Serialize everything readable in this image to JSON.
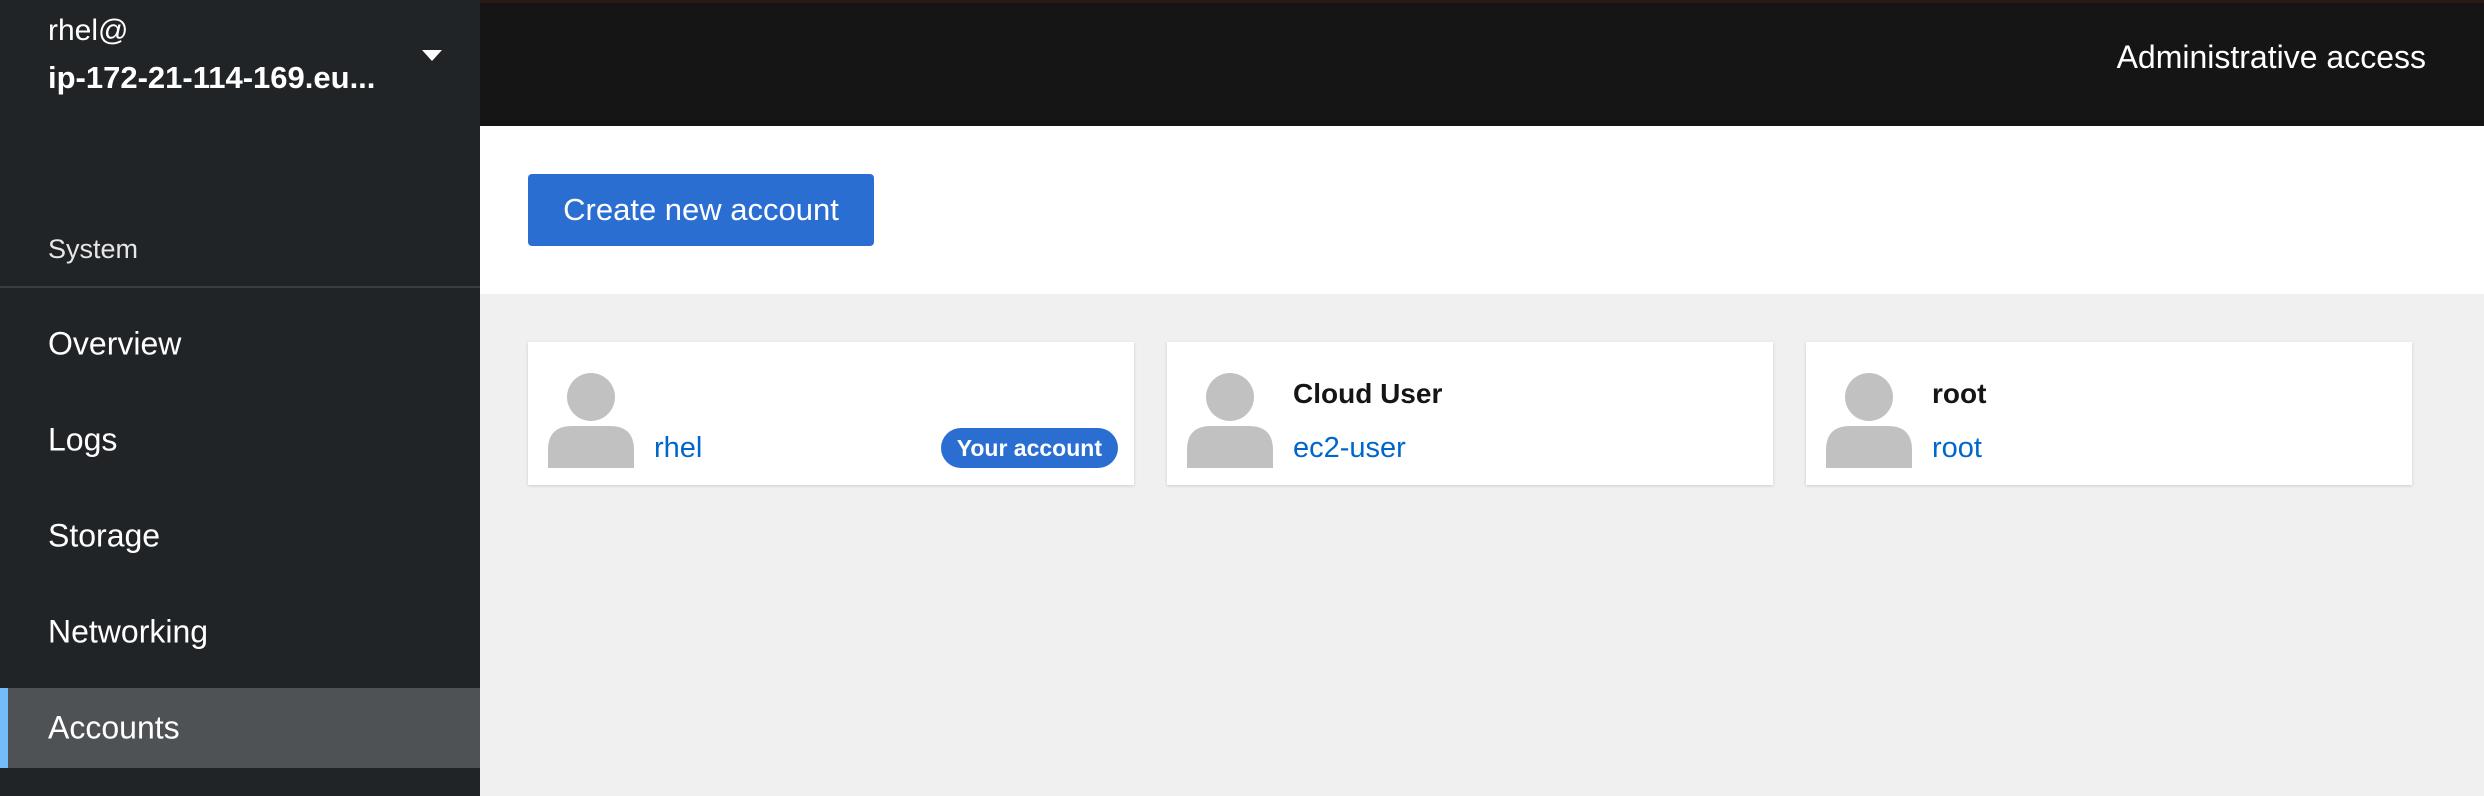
{
  "host": {
    "user": "rhel@",
    "name": "ip-172-21-114-169.eu..."
  },
  "header": {
    "admin_access": "Administrative access"
  },
  "sidebar": {
    "section_label": "System",
    "items": [
      {
        "label": "Overview",
        "active": false
      },
      {
        "label": "Logs",
        "active": false
      },
      {
        "label": "Storage",
        "active": false
      },
      {
        "label": "Networking",
        "active": false
      },
      {
        "label": "Accounts",
        "active": true
      }
    ]
  },
  "toolbar": {
    "create_label": "Create new account"
  },
  "accounts": [
    {
      "full_name": "",
      "login": "rhel",
      "badge": "Your account"
    },
    {
      "full_name": "Cloud User",
      "login": "ec2-user"
    },
    {
      "full_name": "root",
      "login": "root"
    }
  ],
  "colors": {
    "sidebar_bg": "#212427",
    "topbar_bg": "#151515",
    "primary": "#2b6ed2",
    "link": "#0066cc",
    "active_accent": "#73bcf7",
    "content_bg": "#f0f0f0"
  }
}
